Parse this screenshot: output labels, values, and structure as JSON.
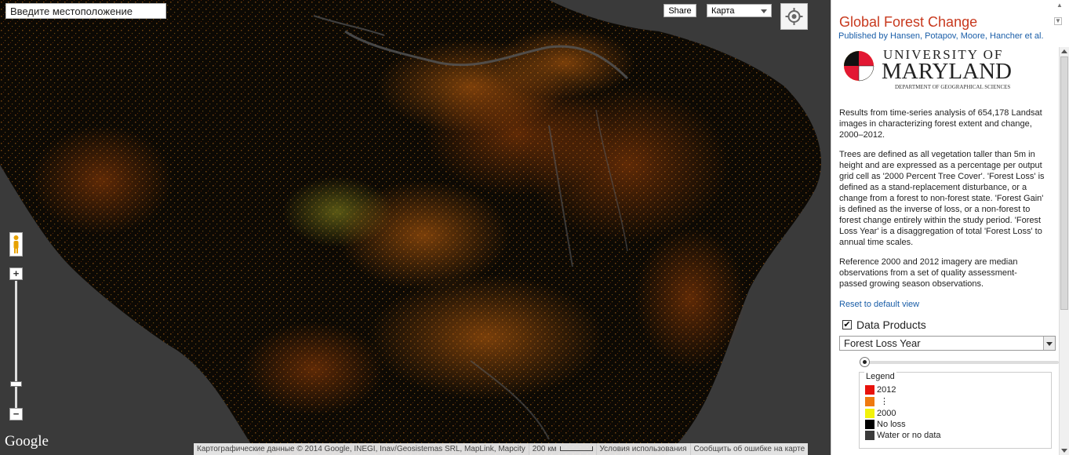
{
  "map": {
    "search_placeholder": "Введите местоположение",
    "share_label": "Share",
    "map_type_selected": "Карта",
    "zoom_in_label": "+",
    "zoom_out_label": "−",
    "google_logo_text": "Google",
    "attribution": {
      "data_text": "Картографические данные © 2014 Google, INEGI, Inav/Geosistemas SRL, MapLink, Mapcity",
      "scale_text": "200 км",
      "terms_text": "Условия использования",
      "report_text": "Сообщить об ошибке на карте"
    }
  },
  "panel": {
    "title": "Global Forest Change",
    "published_by": "Published by Hansen, Potapov, Moore, Hancher et al.",
    "logo": {
      "line1": "UNIVERSITY OF",
      "line2": "MARYLAND",
      "line3": "DEPARTMENT OF GEOGRAPHICAL SCIENCES"
    },
    "paragraphs": [
      "Results from time-series analysis of 654,178 Landsat images in characterizing forest extent and change, 2000–2012.",
      "Trees are defined as all vegetation taller than 5m in height and are expressed as a percentage per output grid cell as '2000 Percent Tree Cover'. 'Forest Loss' is defined as a stand-replacement disturbance, or a change from a forest to non-forest state. 'Forest Gain' is defined as the inverse of loss, or a non-forest to forest change entirely within the study period. 'Forest Loss Year' is a disaggregation of total 'Forest Loss' to annual time scales.",
      "Reference 2000 and 2012 imagery are median observations from a set of quality assessment-passed growing season observations."
    ],
    "reset_link": "Reset to default view",
    "data_products_label": "Data Products",
    "data_products_checked": true,
    "selected_product": "Forest Loss Year",
    "opacity_slider_value": 0,
    "legend": {
      "title": "Legend",
      "items": [
        {
          "label": "2012",
          "color": "#e8120c"
        },
        {
          "label": "⋮",
          "color": "#ef7a10"
        },
        {
          "label": "2000",
          "color": "#f2f20a"
        },
        {
          "label": "No loss",
          "color": "#000000"
        },
        {
          "label": "Water or no data",
          "color": "#3a3a3a"
        }
      ]
    }
  },
  "colors": {
    "map_background": "#3a3a3a",
    "land_dark": "#0c0904",
    "title_red": "#c8391e",
    "link_blue": "#1a5ea8"
  },
  "icons": {
    "locate": "crosshair-icon",
    "pegman": "pegman-icon"
  }
}
